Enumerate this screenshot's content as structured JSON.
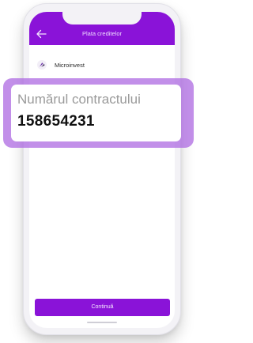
{
  "header": {
    "title": "Plata creditelor"
  },
  "provider": {
    "name": "Microinvest"
  },
  "contract_field": {
    "label": "Numărul contractului",
    "value": "158654231"
  },
  "actions": {
    "continue_label": "Continuă"
  },
  "colors": {
    "brand_purple": "#8a13d8",
    "highlight_overlay": "#aa64e1"
  },
  "icons": {
    "back": "arrow-left-icon",
    "provider_logo": "microinvest-logo-icon"
  }
}
